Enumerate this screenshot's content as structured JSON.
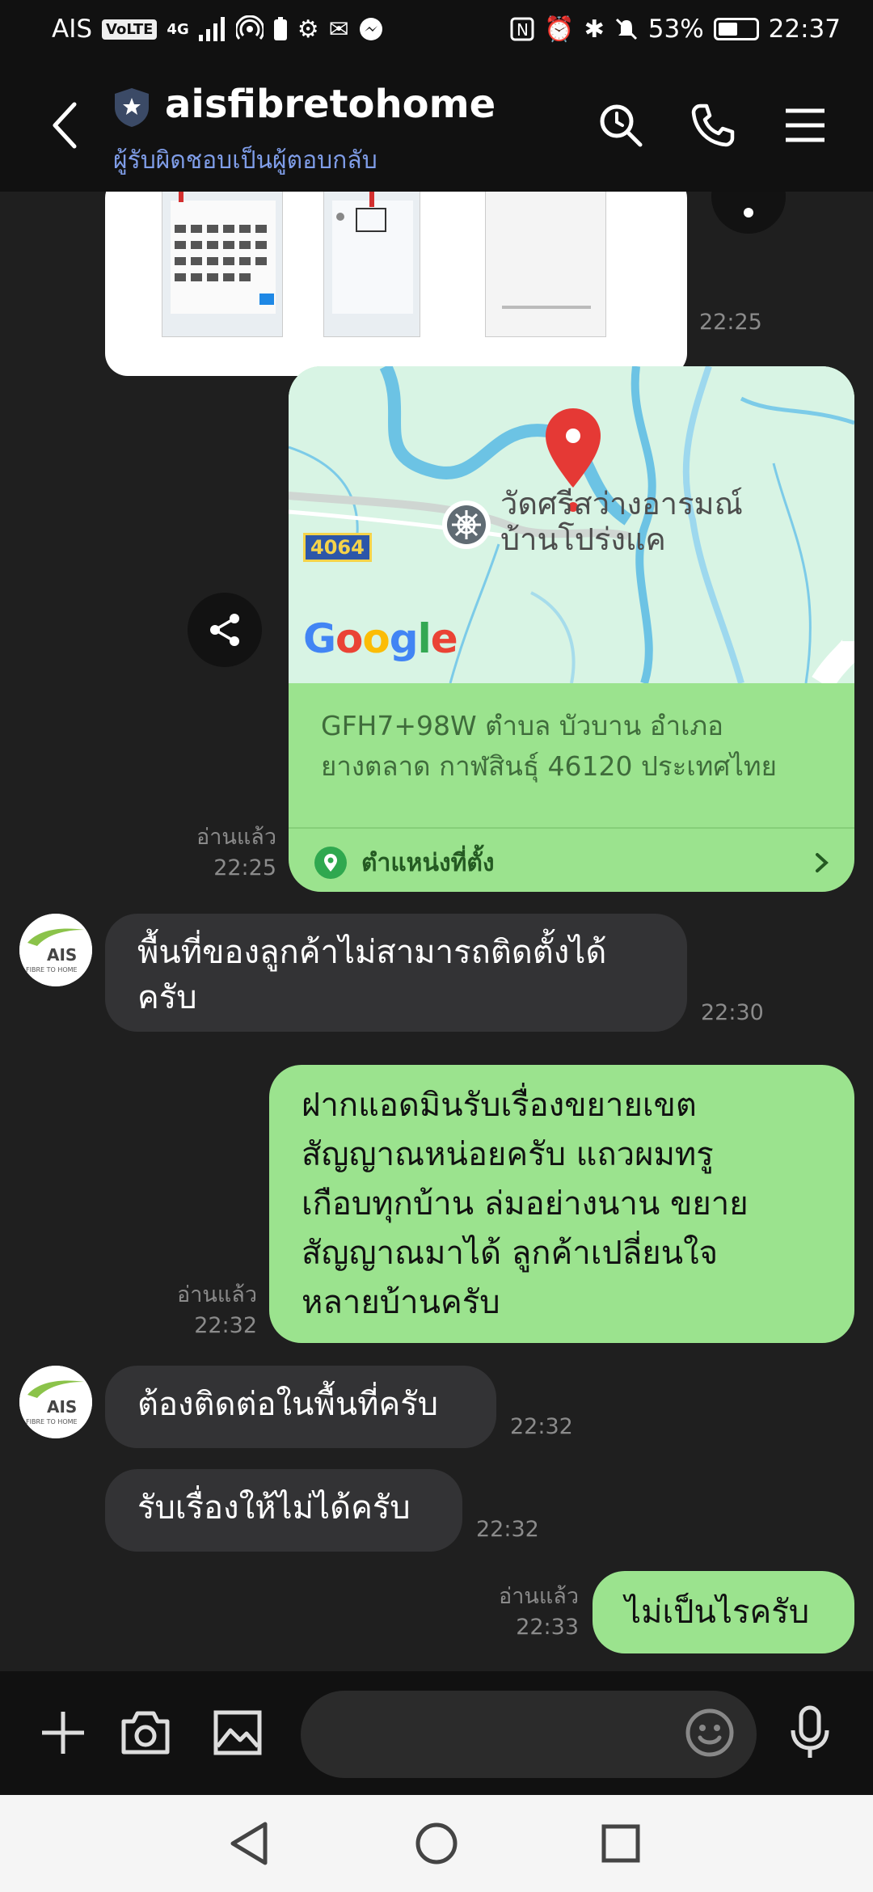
{
  "status_bar": {
    "carrier": "AIS",
    "volte": "VoLTE",
    "network": "4G",
    "battery": "53%",
    "battery_level": 0.53,
    "time": "22:37"
  },
  "header": {
    "title": "aisfibretohome",
    "subtitle": "ผู้รับผิดชอบเป็นผู้ตอบกลับ"
  },
  "messages": {
    "image_time": "22:25",
    "location": {
      "road_number": "4064",
      "place_name_line1": "วัดศรีสว่างอารมณ์",
      "place_name_line2": "บ้านโปร่งแค",
      "map_logo": "Google",
      "address_line1": "GFH7+98W ตำบล บัวบาน อำเภอ",
      "address_line2": "ยางตลาด กาฬสินธุ์ 46120 ประเทศไทย",
      "link_label": "ตำแหน่งที่ตั้ง",
      "read_label": "อ่านแล้ว",
      "time": "22:25"
    },
    "incoming_1": {
      "line1": "พื้นที่ของลูกค้าไม่สามารถติดตั้งได้",
      "line2": "ครับ",
      "time": "22:30"
    },
    "outgoing_1": {
      "line1": "ฝากแอดมินรับเรื่องขยายเขต",
      "line2": "สัญญาณหน่อยครับ แถวผมทรู",
      "line3": "เกือบทุกบ้าน ล่มอย่างนาน ขยาย",
      "line4": "สัญญาณมาได้ ลูกค้าเปลี่ยนใจ",
      "line5": "หลายบ้านครับ",
      "read_label": "อ่านแล้ว",
      "time": "22:32"
    },
    "incoming_2": {
      "text": "ต้องติดต่อในพื้นที่ครับ",
      "time": "22:32"
    },
    "incoming_3": {
      "text": "รับเรื่องให้ไม่ได้ครับ",
      "time": "22:32"
    },
    "outgoing_2": {
      "text": "ไม่เป็นไรครับ",
      "read_label": "อ่านแล้ว",
      "time": "22:33"
    }
  },
  "avatar": {
    "brand": "AIS",
    "tagline": "FIBRE TO HOME"
  },
  "input": {
    "placeholder": ""
  },
  "colors": {
    "outgoing_bubble": "#9be38e",
    "incoming_bubble": "#333335",
    "subtitle": "#7f9de8",
    "map_pin": "#e53935"
  },
  "icons": {
    "header": [
      "back-icon",
      "shield-icon",
      "search-icon",
      "phone-icon",
      "menu-icon"
    ],
    "input_bar": [
      "plus-icon",
      "camera-icon",
      "image-icon",
      "emoji-icon",
      "mic-icon"
    ],
    "nav": [
      "nav-back-icon",
      "nav-home-icon",
      "nav-recents-icon"
    ]
  }
}
